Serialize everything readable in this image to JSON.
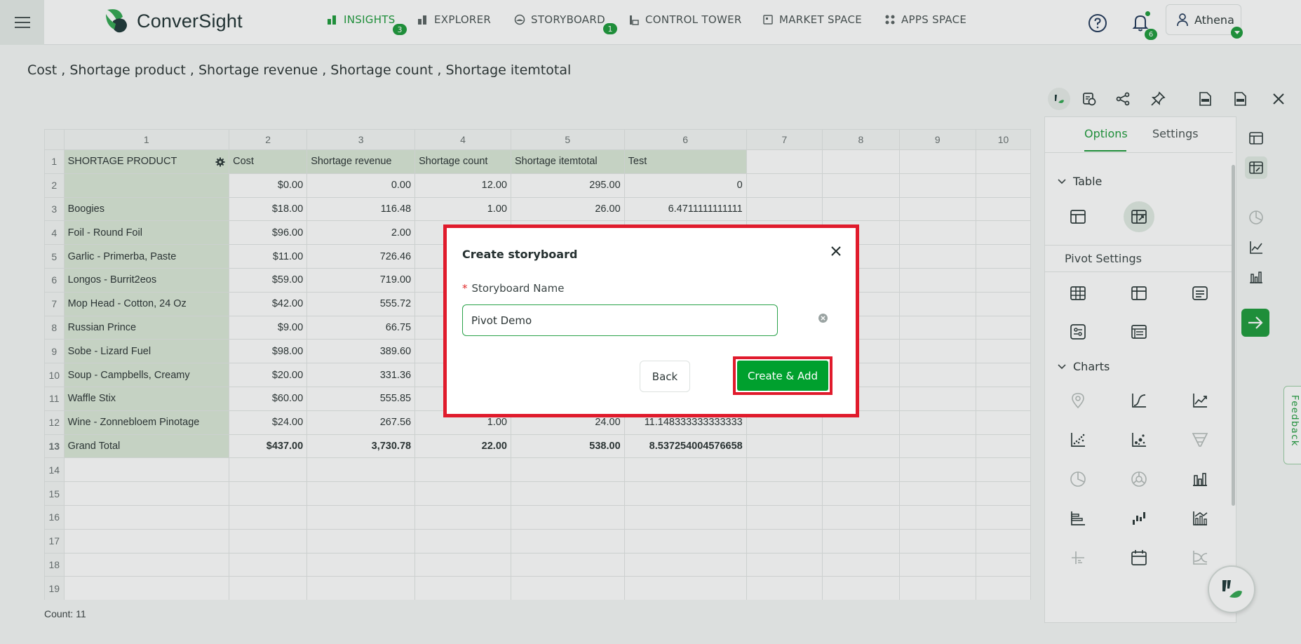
{
  "nav": {
    "brand": "ConverSight",
    "items": [
      {
        "label": "INSIGHTS",
        "badge": "3",
        "active": true
      },
      {
        "label": "EXPLORER",
        "badge": "",
        "active": false
      },
      {
        "label": "STORYBOARD",
        "badge": "1",
        "active": false
      },
      {
        "label": "CONTROL TOWER",
        "badge": "",
        "active": false
      },
      {
        "label": "MARKET SPACE",
        "badge": "",
        "active": false
      },
      {
        "label": "APPS SPACE",
        "badge": "",
        "active": false
      }
    ],
    "notifications_count": "6",
    "user_name": "Athena"
  },
  "query_title": "Cost , Shortage product , Shortage revenue , Shortage count , Shortage itemtotal",
  "sheet": {
    "col_numbers": [
      "1",
      "2",
      "3",
      "4",
      "5",
      "6",
      "7",
      "8",
      "9",
      "10"
    ],
    "headers": [
      "SHORTAGE PRODUCT",
      "Cost",
      "Shortage revenue",
      "Shortage count",
      "Shortage itemtotal",
      "Test"
    ],
    "rows": [
      {
        "n": "2",
        "product": "",
        "cost": "$0.00",
        "revenue": "0.00",
        "count": "12.00",
        "itemtotal": "295.00",
        "test": "0"
      },
      {
        "n": "3",
        "product": "Boogies",
        "cost": "$18.00",
        "revenue": "116.48",
        "count": "1.00",
        "itemtotal": "26.00",
        "test": "6.4711111111111"
      },
      {
        "n": "4",
        "product": "Foil - Round Foil",
        "cost": "$96.00",
        "revenue": "2.00",
        "count": "",
        "itemtotal": "",
        "test": ""
      },
      {
        "n": "5",
        "product": "Garlic - Primerba, Paste",
        "cost": "$11.00",
        "revenue": "726.46",
        "count": "",
        "itemtotal": "",
        "test": ""
      },
      {
        "n": "6",
        "product": "Longos - Burrit2eos",
        "cost": "$59.00",
        "revenue": "719.00",
        "count": "",
        "itemtotal": "",
        "test": ""
      },
      {
        "n": "7",
        "product": "Mop Head - Cotton, 24 Oz",
        "cost": "$42.00",
        "revenue": "555.72",
        "count": "",
        "itemtotal": "",
        "test": ""
      },
      {
        "n": "8",
        "product": "Russian Prince",
        "cost": "$9.00",
        "revenue": "66.75",
        "count": "",
        "itemtotal": "",
        "test": ""
      },
      {
        "n": "9",
        "product": "Sobe - Lizard Fuel",
        "cost": "$98.00",
        "revenue": "389.60",
        "count": "",
        "itemtotal": "",
        "test": ""
      },
      {
        "n": "10",
        "product": "Soup - Campbells, Creamy",
        "cost": "$20.00",
        "revenue": "331.36",
        "count": "",
        "itemtotal": "",
        "test": ""
      },
      {
        "n": "11",
        "product": "Waffle Stix",
        "cost": "$60.00",
        "revenue": "555.85",
        "count": "",
        "itemtotal": "",
        "test": ""
      },
      {
        "n": "12",
        "product": "Wine - Zonnebloem Pinotage",
        "cost": "$24.00",
        "revenue": "267.56",
        "count": "1.00",
        "itemtotal": "24.00",
        "test": "11.148333333333333"
      }
    ],
    "total": {
      "n": "13",
      "product": "Grand Total",
      "cost": "$437.00",
      "revenue": "3,730.78",
      "count": "22.00",
      "itemtotal": "538.00",
      "test": "8.537254004576658"
    },
    "empty_rows": [
      "14",
      "15",
      "16",
      "17",
      "18",
      "19"
    ],
    "count_label": "Count: 11"
  },
  "panel": {
    "tabs": [
      "Options",
      "Settings"
    ],
    "table_section": "Table",
    "pivot_settings": "Pivot Settings",
    "charts_section": "Charts"
  },
  "feedback_label": "Feedback",
  "modal": {
    "title": "Create storyboard",
    "field_label": "Storyboard Name",
    "required_mark": "*",
    "input_value": "Pivot Demo",
    "back_label": "Back",
    "create_label": "Create & Add"
  },
  "colors": {
    "accent": "#1e9b3c",
    "highlight": "#e01b2c",
    "header_fill": "#dbe9d8"
  }
}
